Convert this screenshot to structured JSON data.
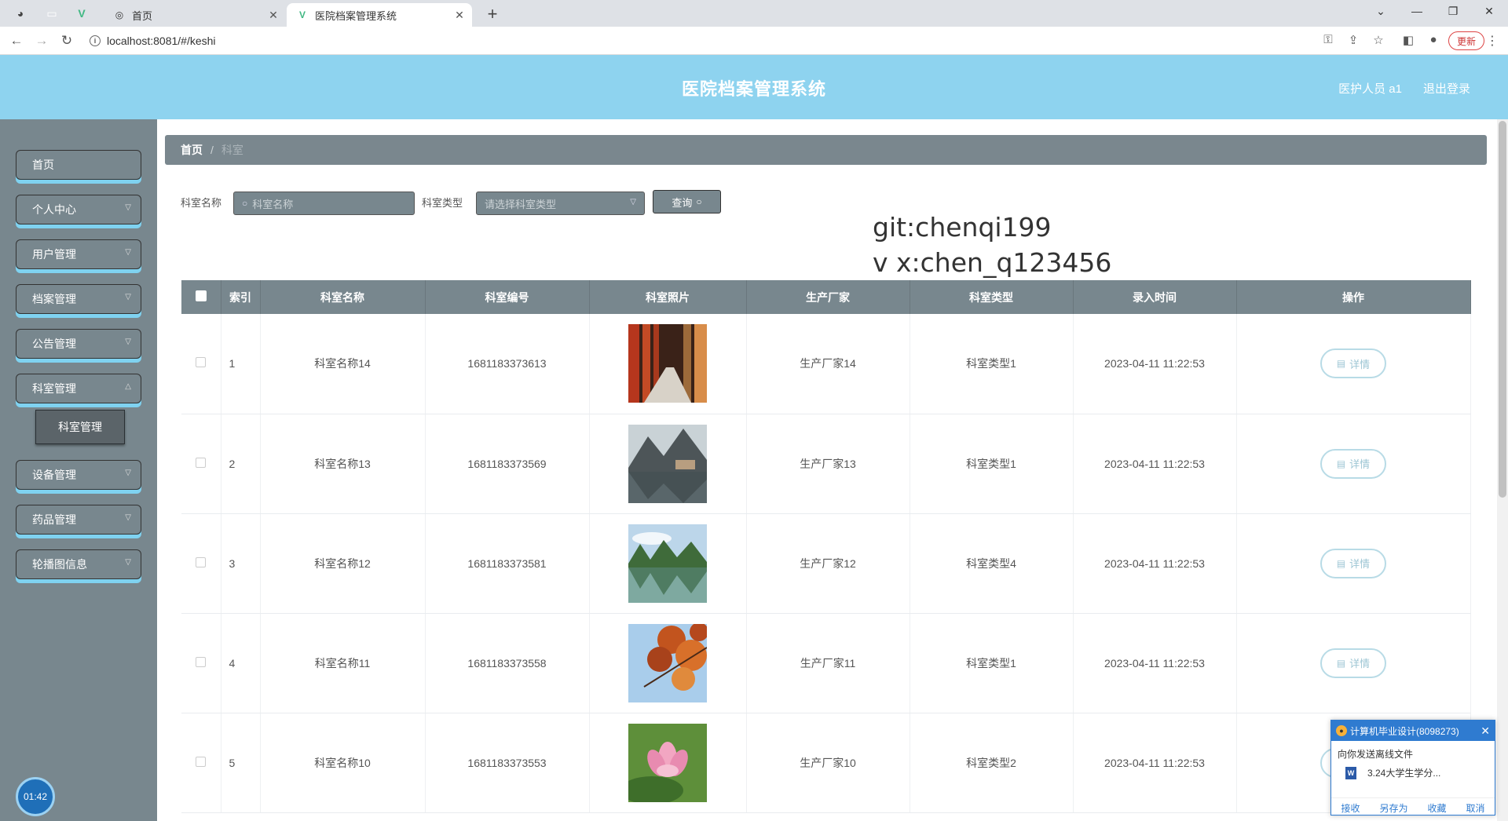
{
  "browser": {
    "tabs": [
      {
        "title": "首页",
        "active": false
      },
      {
        "title": "医院档案管理系统",
        "active": true
      }
    ],
    "url": "localhost:8081/#/keshi",
    "update_label": "更新"
  },
  "app": {
    "title": "医院档案管理系统",
    "user_label": "医护人员 a1",
    "logout_label": "退出登录"
  },
  "sidebar": {
    "items": [
      {
        "label": "首页",
        "has_submenu": false
      },
      {
        "label": "个人中心",
        "has_submenu": true
      },
      {
        "label": "用户管理",
        "has_submenu": true
      },
      {
        "label": "档案管理",
        "has_submenu": true
      },
      {
        "label": "公告管理",
        "has_submenu": true
      },
      {
        "label": "科室管理",
        "has_submenu": true,
        "expanded": true
      },
      {
        "label": "设备管理",
        "has_submenu": true
      },
      {
        "label": "药品管理",
        "has_submenu": true
      },
      {
        "label": "轮播图信息",
        "has_submenu": true
      }
    ],
    "active_submenu": "科室管理",
    "clock": "01:42"
  },
  "breadcrumb": {
    "home": "首页",
    "separator": "/",
    "current": "科室"
  },
  "search": {
    "name_label": "科室名称",
    "name_placeholder": "科室名称",
    "type_label": "科室类型",
    "type_placeholder": "请选择科室类型",
    "query_label": "查询"
  },
  "overlay": {
    "line1": "git:chenqi199",
    "line2": "v x:chen_q123456"
  },
  "table": {
    "headers": [
      "索引",
      "科室名称",
      "科室编号",
      "科室照片",
      "生产厂家",
      "科室类型",
      "录入时间",
      "操作"
    ],
    "detail_label": "详情",
    "rows": [
      {
        "index": "1",
        "name": "科室名称14",
        "code": "1681183373613",
        "photo": "corridor",
        "maker": "生产厂家14",
        "type": "科室类型1",
        "time": "2023-04-11 11:22:53"
      },
      {
        "index": "2",
        "name": "科室名称13",
        "code": "1681183373569",
        "photo": "lake-village",
        "maker": "生产厂家13",
        "type": "科室类型1",
        "time": "2023-04-11 11:22:53"
      },
      {
        "index": "3",
        "name": "科室名称12",
        "code": "1681183373581",
        "photo": "mountain-river",
        "maker": "生产厂家12",
        "type": "科室类型4",
        "time": "2023-04-11 11:22:53"
      },
      {
        "index": "4",
        "name": "科室名称11",
        "code": "1681183373558",
        "photo": "autumn-leaves",
        "maker": "生产厂家11",
        "type": "科室类型1",
        "time": "2023-04-11 11:22:53"
      },
      {
        "index": "5",
        "name": "科室名称10",
        "code": "1681183373553",
        "photo": "lotus",
        "maker": "生产厂家10",
        "type": "科室类型2",
        "time": "2023-04-11 11:22:53"
      }
    ]
  },
  "notification": {
    "title": "计算机毕业设计(8098273)",
    "message": "向你发送离线文件",
    "file": "3.24大学生学分...",
    "actions": [
      "接收",
      "另存为",
      "收藏",
      "取消"
    ]
  },
  "colors": {
    "header": "#8ed3ef",
    "sidebar": "#78878e",
    "accent": "#7fd2f0"
  }
}
